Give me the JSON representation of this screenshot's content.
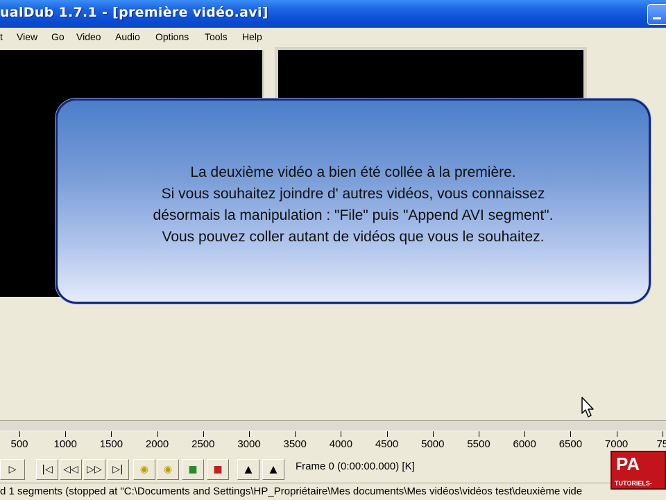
{
  "window": {
    "title": "ualDub 1.7.1 - [première vidéo.avi]"
  },
  "menu": {
    "items": [
      "t",
      "View",
      "Go",
      "Video",
      "Audio",
      "Options",
      "Tools",
      "Help"
    ]
  },
  "overlay": {
    "lines": [
      "La deuxième vidéo a bien été collée à la première.",
      "Si vous souhaitez joindre d' autres vidéos, vous connaissez",
      "désormais la manipulation : \"File\" puis \"Append AVI segment\".",
      "Vous pouvez coller autant de vidéos que vous le souhaitez."
    ]
  },
  "timeline": {
    "labels": [
      "500",
      "1000",
      "1500",
      "2000",
      "2500",
      "3000",
      "3500",
      "4000",
      "4500",
      "5000",
      "5500",
      "6000",
      "6500",
      "7000",
      "75"
    ]
  },
  "toolbar": {
    "frame_readout": "Frame 0 (0:00:00.000) [K]"
  },
  "statusbar": {
    "text": "d 1 segments (stopped at \"C:\\Documents and Settings\\HP_Propriétaire\\Mes documents\\Mes vidéos\\vidéos test\\deuxième vide"
  },
  "watermark": {
    "big": "PA",
    "small": "TUTORIELS-"
  },
  "icons": {
    "toolbar_buttons": [
      "play-output-icon",
      "go-start-icon",
      "prev-frame-icon",
      "next-frame-icon",
      "go-end-icon",
      "prev-key-icon",
      "next-key-icon",
      "prev-scene-icon",
      "next-scene-icon",
      "mark-in-icon",
      "mark-out-icon"
    ]
  }
}
